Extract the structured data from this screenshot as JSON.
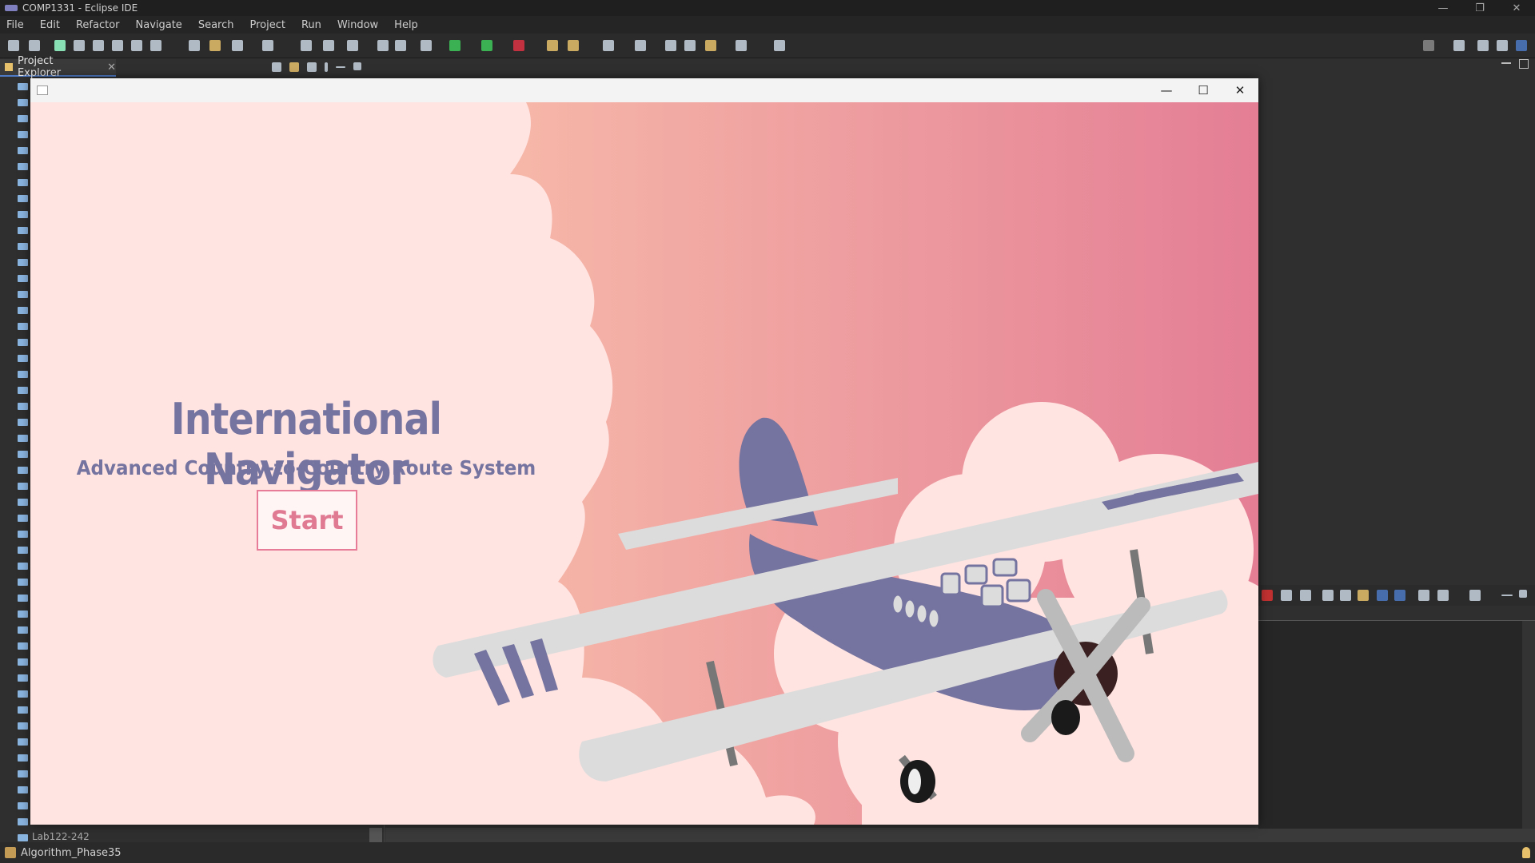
{
  "eclipse": {
    "window_title": "COMP1331 - Eclipse IDE",
    "menu": [
      "File",
      "Edit",
      "Refactor",
      "Navigate",
      "Search",
      "Project",
      "Run",
      "Window",
      "Help"
    ],
    "project_explorer_tab": "Project Explorer",
    "partial_tree_item": "Lab122-242",
    "status_text": "Algorithm_Phase35"
  },
  "app_window": {
    "heading": "International Navigator",
    "subheading": "Advanced Country-to-Country Route System",
    "start_label": "Start",
    "colors": {
      "heading": "#75739f",
      "button_text": "#e07a93",
      "background": "#ffe4e1",
      "gradient_start": "#f6b7a8",
      "gradient_end": "#e47e95",
      "plane_body": "#75739f",
      "plane_wing": "#dcdcdc"
    }
  }
}
